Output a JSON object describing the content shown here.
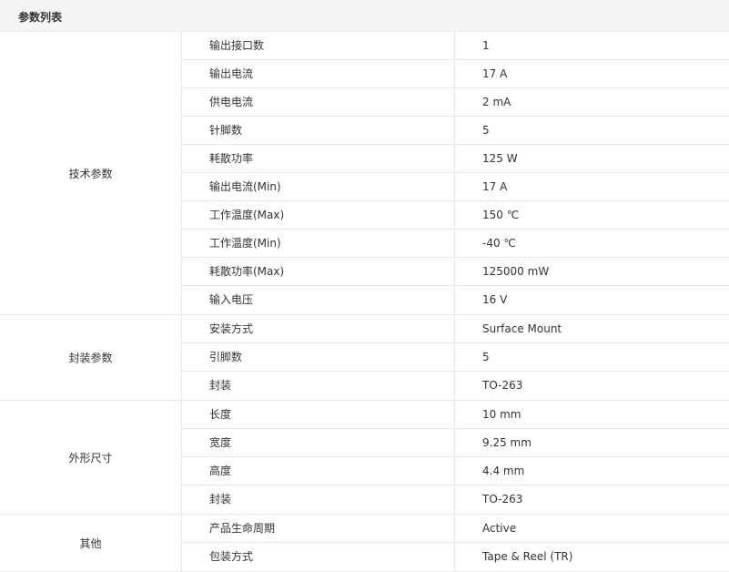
{
  "title": "参数列表",
  "groups": [
    {
      "label": "技术参数",
      "rows": [
        {
          "name": "输出接口数",
          "value": "1"
        },
        {
          "name": "输出电流",
          "value": "17 A"
        },
        {
          "name": "供电电流",
          "value": "2 mA"
        },
        {
          "name": "针脚数",
          "value": "5"
        },
        {
          "name": "耗散功率",
          "value": "125 W"
        },
        {
          "name": "输出电流(Min)",
          "value": "17 A"
        },
        {
          "name": "工作温度(Max)",
          "value": "150 ℃"
        },
        {
          "name": "工作温度(Min)",
          "value": "-40 ℃"
        },
        {
          "name": "耗散功率(Max)",
          "value": "125000 mW"
        },
        {
          "name": "输入电压",
          "value": "16 V"
        }
      ]
    },
    {
      "label": "封装参数",
      "rows": [
        {
          "name": "安装方式",
          "value": "Surface Mount"
        },
        {
          "name": "引脚数",
          "value": "5"
        },
        {
          "name": "封装",
          "value": "TO-263"
        }
      ]
    },
    {
      "label": "外形尺寸",
      "rows": [
        {
          "name": "长度",
          "value": "10 mm"
        },
        {
          "name": "宽度",
          "value": "9.25 mm"
        },
        {
          "name": "高度",
          "value": "4.4 mm"
        },
        {
          "name": "封装",
          "value": "TO-263"
        }
      ]
    },
    {
      "label": "其他",
      "rows": [
        {
          "name": "产品生命周期",
          "value": "Active"
        },
        {
          "name": "包装方式",
          "value": "Tape & Reel (TR)"
        }
      ]
    }
  ]
}
